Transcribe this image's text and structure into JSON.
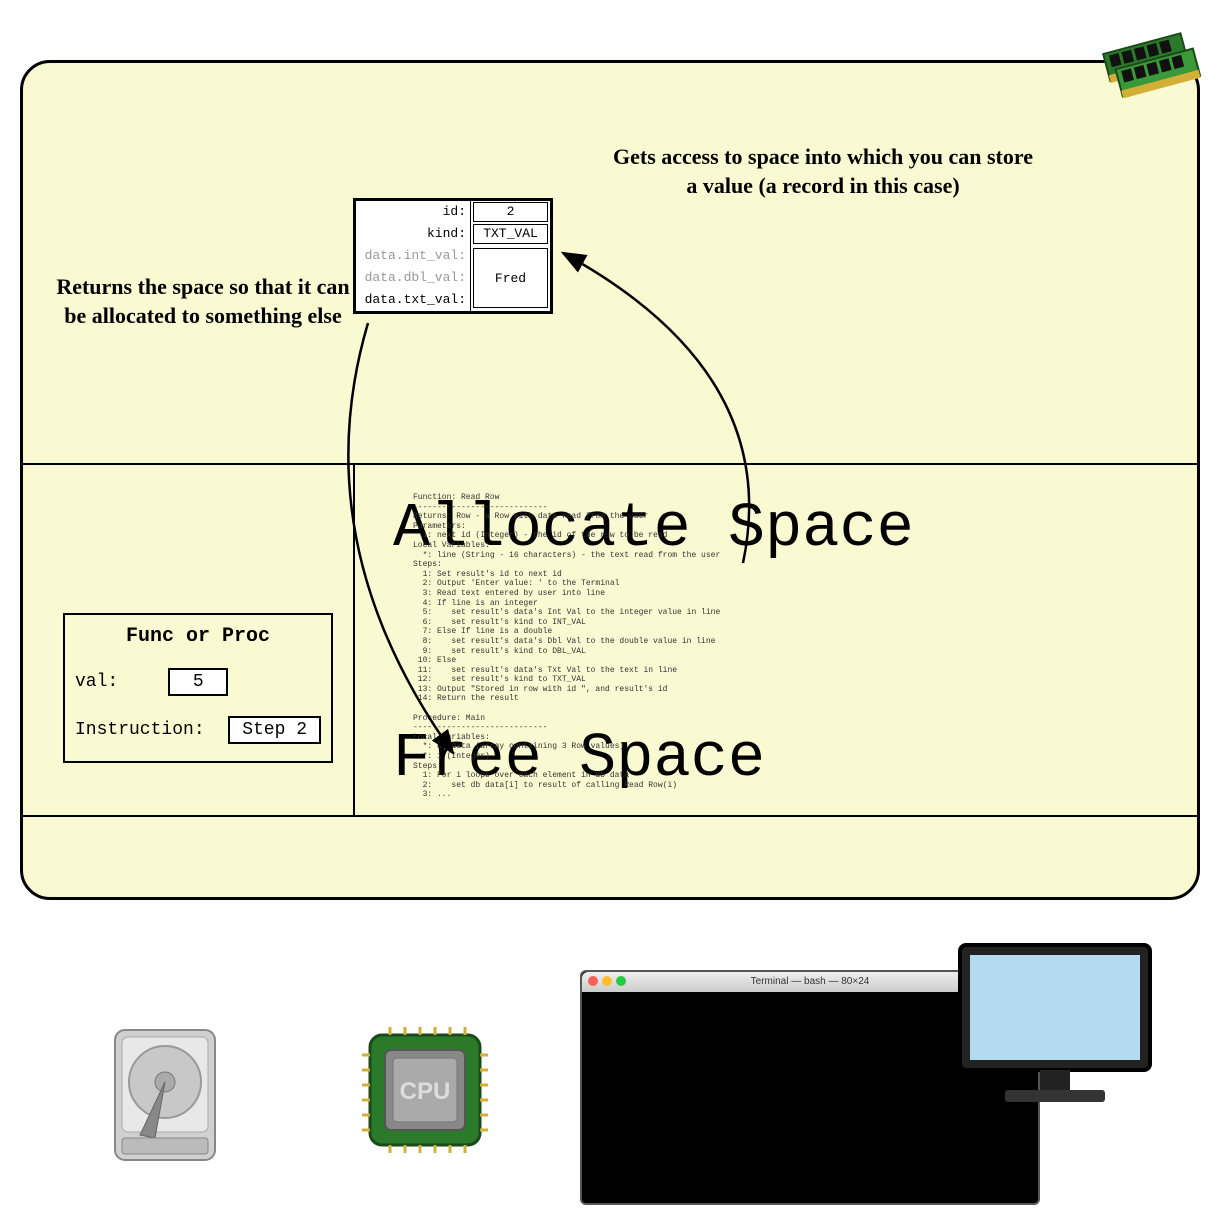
{
  "annotations": {
    "right": "Gets access to space into which you can store a value (a record in this case)",
    "left": "Returns the space so that it can be allocated to something else"
  },
  "record": {
    "fields": {
      "id": {
        "label": "id:",
        "value": "2"
      },
      "kind": {
        "label": "kind:",
        "value": "TXT_VAL"
      },
      "int_val": {
        "label": "data.int_val:",
        "grey": true
      },
      "dbl_val": {
        "label": "data.dbl_val:",
        "grey": true
      },
      "txt_val": {
        "label": "data.txt_val:"
      }
    },
    "union_value": "Fred"
  },
  "func_box": {
    "title": "Func or Proc",
    "val_label": "val:",
    "val_value": "5",
    "instr_label": "Instruction:",
    "instr_value": "Step 2"
  },
  "big_labels": {
    "allocate": "Allocate Space",
    "free": "Free Space"
  },
  "pseudocode": "Function: Read Row\n----------------------------\nReturns: Row - a Row with data read from the user\nParameters:\n  1: next id (Integer) - the id of the row to be read\nLocal Variables:\n  *: line (String - 16 characters) - the text read from the user\nSteps:\n  1: Set result's id to next id\n  2: Output 'Enter value: ' to the Terminal\n  3: Read text entered by user into line\n  4: If line is an integer\n  5:    set result's data's Int Val to the integer value in line\n  6:    set result's kind to INT_VAL\n  7: Else If line is a double\n  8:    set result's data's Dbl Val to the double value in line\n  9:    set result's kind to DBL_VAL\n 10: Else\n 11:    set result's data's Txt Val to the text in line\n 12:    set result's kind to TXT_VAL\n 13: Output \"Stored in row with id \", and result's id\n 14: Return the result\n\nProcedure: Main\n----------------------------\nLocal Variables:\n  *: db data (array containing 3 Row values)\n  *: i (Integer)\nSteps:\n  1: For i loops over each element in db data\n  2:    set db data[i] to result of calling Read Row(i)\n  3: ...",
  "terminal": {
    "title": "Terminal — bash — 80×24"
  }
}
